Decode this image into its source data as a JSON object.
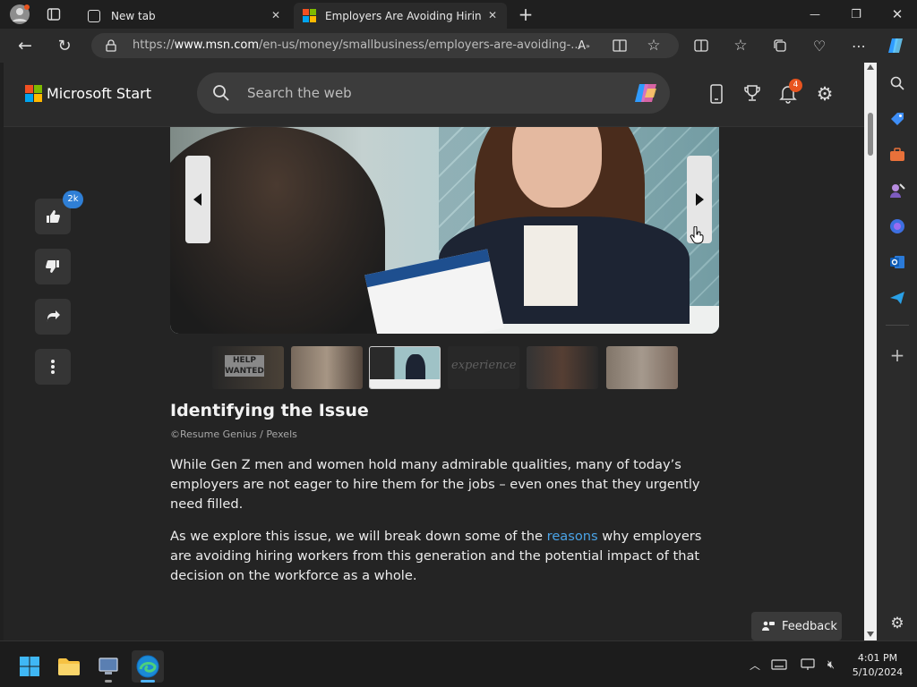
{
  "tabs": [
    {
      "title": "New tab"
    },
    {
      "title": "Employers Are Avoiding Hiring G"
    }
  ],
  "window_controls": {
    "minimize": "—",
    "maximize": "❐",
    "close": "✕"
  },
  "address": {
    "url_prefix": "https://",
    "url_domain": "www.msn.com",
    "url_path": "/en-us/money/smallbusiness/employers-are-avoiding-..."
  },
  "msn": {
    "brand": "Microsoft Start",
    "search_placeholder": "Search the web",
    "notification_count": "4"
  },
  "reactions": {
    "like_count": "2k"
  },
  "article": {
    "heading": "Identifying the Issue",
    "credit": "©Resume Genius / Pexels",
    "para1": "While Gen Z men and women hold many admirable qualities, many of today’s employers are not eager to hire them for the jobs – even ones that they urgently need filled.",
    "para2_before": "As we explore this issue, we will break down some of the ",
    "para2_link": "reasons",
    "para2_after": " why employers are avoiding hiring workers from this generation and the potential impact of that decision on the workforce as a whole."
  },
  "thumbnails": [
    {
      "label": "HELP WANTED"
    },
    {
      "label": ""
    },
    {
      "label": ""
    },
    {
      "label": "experience"
    },
    {
      "label": ""
    },
    {
      "label": ""
    }
  ],
  "feedback": {
    "label": "Feedback"
  },
  "clock": {
    "time": "4:01 PM",
    "date": "5/10/2024"
  },
  "colors": {
    "accent": "#4aa3e6",
    "badge": "#e8541f",
    "like_badge": "#2f7fd6"
  }
}
